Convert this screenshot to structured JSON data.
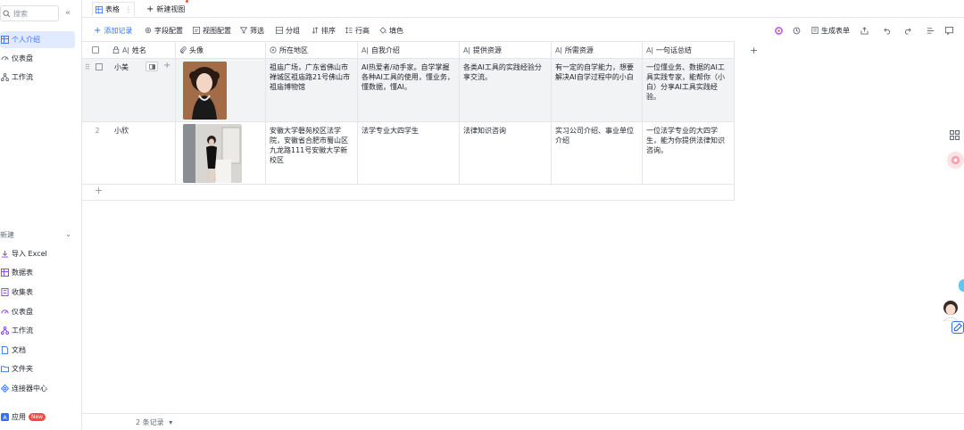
{
  "sidebar": {
    "search_placeholder": "搜索",
    "items": [
      {
        "label": "个人介绍",
        "active": true
      },
      {
        "label": "仪表盘"
      },
      {
        "label": "工作流"
      }
    ],
    "new_section": {
      "title": "新建",
      "items": [
        {
          "label": "导入 Excel"
        },
        {
          "label": "数据表"
        },
        {
          "label": "收集表"
        },
        {
          "label": "仪表盘"
        },
        {
          "label": "工作流"
        },
        {
          "label": "文档"
        },
        {
          "label": "文件夹"
        },
        {
          "label": "连接器中心"
        }
      ]
    },
    "apps": {
      "label": "应用",
      "badge": "New"
    }
  },
  "tabs": {
    "active": "表格",
    "new_view": "新建视图"
  },
  "toolbar": {
    "add_record": "添加记录",
    "field_config": "字段配置",
    "view_config": "视图配置",
    "filter": "筛选",
    "group": "分组",
    "sort": "排序",
    "row_height": "行高",
    "fill_color": "填色",
    "generate_form": "生成表单"
  },
  "columns": [
    "姓名",
    "头像",
    "所在地区",
    "自我介绍",
    "提供资源",
    "所需资源",
    "一句话总结"
  ],
  "rows": [
    {
      "index": "",
      "name": "小美",
      "region": "祖庙广场，广东省佛山市禅城区祖庙路21号佛山市祖庙博物馆",
      "intro": "AI热爱者/动手家。自学掌握各种AI工具的使用，懂业务，懂数据，懂AI。",
      "provide": "各类AI工具的实践经验分享交流。",
      "need": "有一定的自学能力，想要解决AI自学过程中的小白",
      "summary": "一位懂业务、数据的AI工具实践专家，能帮你（小白）分享AI工具实践经验。"
    },
    {
      "index": "2",
      "name": "小欣",
      "region": "安徽大学磬苑校区法学院，安徽省合肥市蜀山区九龙路111号安徽大学新校区",
      "intro": "法学专业大四学生",
      "provide": "法律知识咨询",
      "need": "实习公司介绍、事业单位介绍",
      "summary": "一位法学专业的大四学生，能为你提供法律知识咨询。"
    }
  ],
  "footer": {
    "record_count": "2 条记录"
  }
}
